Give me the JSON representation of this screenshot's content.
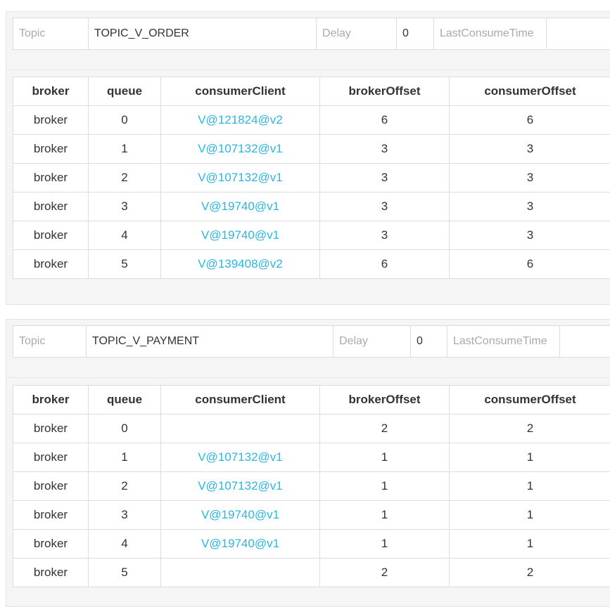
{
  "columns": [
    "broker",
    "queue",
    "consumerClient",
    "brokerOffset",
    "consumerOffset"
  ],
  "labels": {
    "topic": "Topic",
    "delay": "Delay",
    "last_consume_time": "LastConsumeTime"
  },
  "colors": {
    "link": "#29b6e0",
    "panel_bg": "#f5f5f5",
    "border": "#dddddd"
  },
  "groups": [
    {
      "topic": "TOPIC_V_ORDER",
      "delay": "0",
      "last_consume_time": "",
      "rows": [
        {
          "broker": "broker",
          "queue": "0",
          "client": "V@121824@v2",
          "broker_offset": "6",
          "consumer_offset": "6"
        },
        {
          "broker": "broker",
          "queue": "1",
          "client": "V@107132@v1",
          "broker_offset": "3",
          "consumer_offset": "3"
        },
        {
          "broker": "broker",
          "queue": "2",
          "client": "V@107132@v1",
          "broker_offset": "3",
          "consumer_offset": "3"
        },
        {
          "broker": "broker",
          "queue": "3",
          "client": "V@19740@v1",
          "broker_offset": "3",
          "consumer_offset": "3"
        },
        {
          "broker": "broker",
          "queue": "4",
          "client": "V@19740@v1",
          "broker_offset": "3",
          "consumer_offset": "3"
        },
        {
          "broker": "broker",
          "queue": "5",
          "client": "V@139408@v2",
          "broker_offset": "6",
          "consumer_offset": "6"
        }
      ]
    },
    {
      "topic": "TOPIC_V_PAYMENT",
      "delay": "0",
      "last_consume_time": "",
      "rows": [
        {
          "broker": "broker",
          "queue": "0",
          "client": "",
          "broker_offset": "2",
          "consumer_offset": "2"
        },
        {
          "broker": "broker",
          "queue": "1",
          "client": "V@107132@v1",
          "broker_offset": "1",
          "consumer_offset": "1"
        },
        {
          "broker": "broker",
          "queue": "2",
          "client": "V@107132@v1",
          "broker_offset": "1",
          "consumer_offset": "1"
        },
        {
          "broker": "broker",
          "queue": "3",
          "client": "V@19740@v1",
          "broker_offset": "1",
          "consumer_offset": "1"
        },
        {
          "broker": "broker",
          "queue": "4",
          "client": "V@19740@v1",
          "broker_offset": "1",
          "consumer_offset": "1"
        },
        {
          "broker": "broker",
          "queue": "5",
          "client": "",
          "broker_offset": "2",
          "consumer_offset": "2"
        }
      ]
    }
  ]
}
